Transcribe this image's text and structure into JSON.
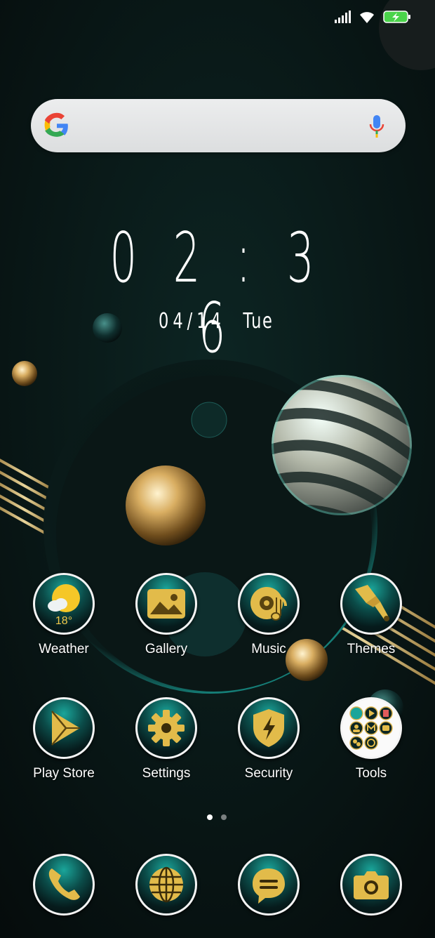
{
  "status_bar": {
    "icons": [
      "signal-icon",
      "wifi-icon",
      "battery-charging-icon"
    ]
  },
  "search": {
    "logo": "google-g-icon",
    "mic": "mic-icon"
  },
  "clock": {
    "time": "0 2 : 3 6",
    "date": "04/14",
    "weekday": "Tue"
  },
  "weather": {
    "temperature": "18°"
  },
  "apps_row1": [
    {
      "label": "Weather",
      "icon": "weather-icon"
    },
    {
      "label": "Gallery",
      "icon": "gallery-icon"
    },
    {
      "label": "Music",
      "icon": "music-icon"
    },
    {
      "label": "Themes",
      "icon": "brush-icon"
    }
  ],
  "apps_row2": [
    {
      "label": "Play Store",
      "icon": "play-store-icon"
    },
    {
      "label": "Settings",
      "icon": "gear-icon"
    },
    {
      "label": "Security",
      "icon": "shield-icon"
    },
    {
      "label": "Tools",
      "icon": "folder-icon"
    }
  ],
  "dock": [
    {
      "icon": "phone-icon"
    },
    {
      "icon": "browser-icon"
    },
    {
      "icon": "messages-icon"
    },
    {
      "icon": "camera-icon"
    }
  ],
  "pages": {
    "count": 2,
    "current": 1
  },
  "colors": {
    "gold": "#e7bf4a",
    "teal": "#1aa59a",
    "bg": "#07100f"
  }
}
